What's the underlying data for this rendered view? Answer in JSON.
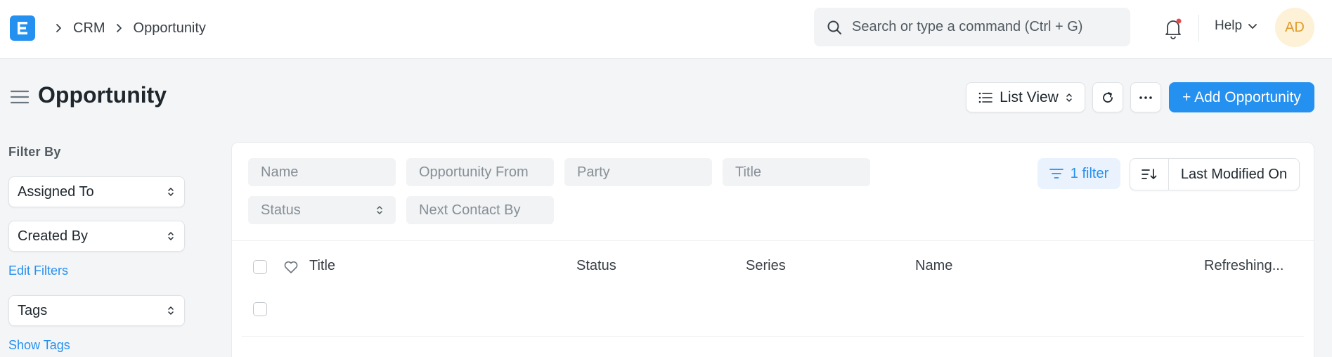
{
  "navbar": {
    "breadcrumbs": [
      "CRM",
      "Opportunity"
    ],
    "search_placeholder": "Search or type a command (Ctrl + G)",
    "help_label": "Help",
    "avatar_initials": "AD"
  },
  "page": {
    "title": "Opportunity",
    "list_view_label": "List View",
    "add_button_label": "+ Add Opportunity"
  },
  "sidebar": {
    "filter_by_label": "Filter By",
    "assigned_to_label": "Assigned To",
    "created_by_label": "Created By",
    "edit_filters_label": "Edit Filters",
    "tags_label": "Tags",
    "show_tags_label": "Show Tags"
  },
  "filters": {
    "name_placeholder": "Name",
    "opportunity_from_placeholder": "Opportunity From",
    "party_placeholder": "Party",
    "title_placeholder": "Title",
    "status_placeholder": "Status",
    "next_contact_by_placeholder": "Next Contact By",
    "filter_button_label": "1 filter",
    "sort_label": "Last Modified On"
  },
  "list": {
    "columns": {
      "title": "Title",
      "status": "Status",
      "series": "Series",
      "name": "Name",
      "refreshing": "Refreshing..."
    }
  },
  "colors": {
    "accent": "#2490ef",
    "avatar_bg": "#fdf1d7",
    "avatar_text": "#e09b28",
    "notification_dot": "#e24c4c"
  }
}
